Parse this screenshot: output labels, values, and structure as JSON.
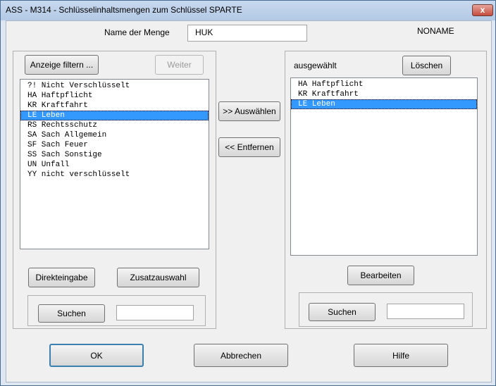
{
  "window": {
    "title": "ASS - M314 - Schlüsselinhaltsmengen zum Schlüssel SPARTE",
    "close_glyph": "x"
  },
  "header": {
    "name_label": "Name der Menge",
    "name_value": "HUK",
    "noname": "NONAME"
  },
  "left": {
    "filter_button": "Anzeige filtern ...",
    "weiter_button": "Weiter",
    "items": [
      {
        "text": "?! Nicht Verschlüsselt"
      },
      {
        "text": "HA Haftpflicht"
      },
      {
        "text": "KR Kraftfahrt"
      },
      {
        "text": "LE Leben"
      },
      {
        "text": "RS Rechtsschutz"
      },
      {
        "text": "SA Sach Allgemein"
      },
      {
        "text": "SF Sach Feuer"
      },
      {
        "text": "SS Sach Sonstige"
      },
      {
        "text": "UN Unfall"
      },
      {
        "text": "YY nicht verschlüsselt"
      }
    ],
    "selected_index": 3,
    "direkteingabe_button": "Direkteingabe",
    "zusatzauswahl_button": "Zusatzauswahl",
    "suchen_button": "Suchen",
    "search_value": ""
  },
  "middle": {
    "auswaehlen_button": ">> Auswählen",
    "entfernen_button": "<< Entfernen"
  },
  "right": {
    "label": "ausgewählt",
    "loeschen_button": "Löschen",
    "items": [
      {
        "text": "HA Haftpflicht"
      },
      {
        "text": "KR Kraftfahrt"
      },
      {
        "text": "LE Leben"
      }
    ],
    "selected_index": 2,
    "bearbeiten_button": "Bearbeiten",
    "suchen_button": "Suchen",
    "search_value": ""
  },
  "footer": {
    "ok_button": "OK",
    "abbrechen_button": "Abbrechen",
    "hilfe_button": "Hilfe"
  }
}
